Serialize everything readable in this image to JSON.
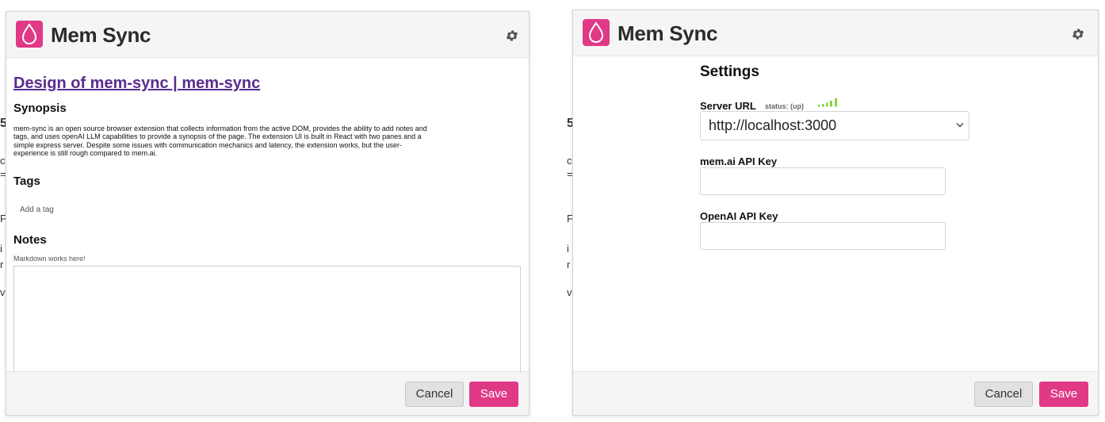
{
  "app": {
    "title": "Mem Sync"
  },
  "left": {
    "page_title": "Design of mem-sync | mem-sync",
    "synopsis_heading": "Synopsis",
    "synopsis_lines": [
      "mem-sync is an open source browser extension that collects information from the active DOM, provides the ability to add notes and",
      "tags, and uses openAI LLM capabilities to provide a synopsis of the page. The extension UI is built in React with two panes and a",
      "simple express server. Despite some issues with communication mechanics and latency, the extension works, but the user-",
      "experience is still rough compared to mem.ai."
    ],
    "tags_heading": "Tags",
    "tag_placeholder": "Add a tag",
    "notes_heading": "Notes",
    "notes_hint": "Markdown works here!",
    "notes_value": ""
  },
  "right": {
    "settings_title": "Settings",
    "server_url_label": "Server URL",
    "server_status": "status: (up)",
    "server_url_value": "http://localhost:3000",
    "mem_key_label": "mem.ai API Key",
    "mem_key_value": "",
    "openai_key_label": "OpenAI API Key",
    "openai_key_value": ""
  },
  "footer": {
    "cancel_label": "Cancel",
    "save_label": "Save"
  },
  "colors": {
    "brand": "#e03a86",
    "link": "#5a2c8e",
    "signal": "#8ccf3f"
  },
  "icons": {
    "logo": "drop-icon",
    "settings": "gear-icon",
    "dropdown": "chevron-down-icon",
    "status": "signal-bars-icon"
  }
}
